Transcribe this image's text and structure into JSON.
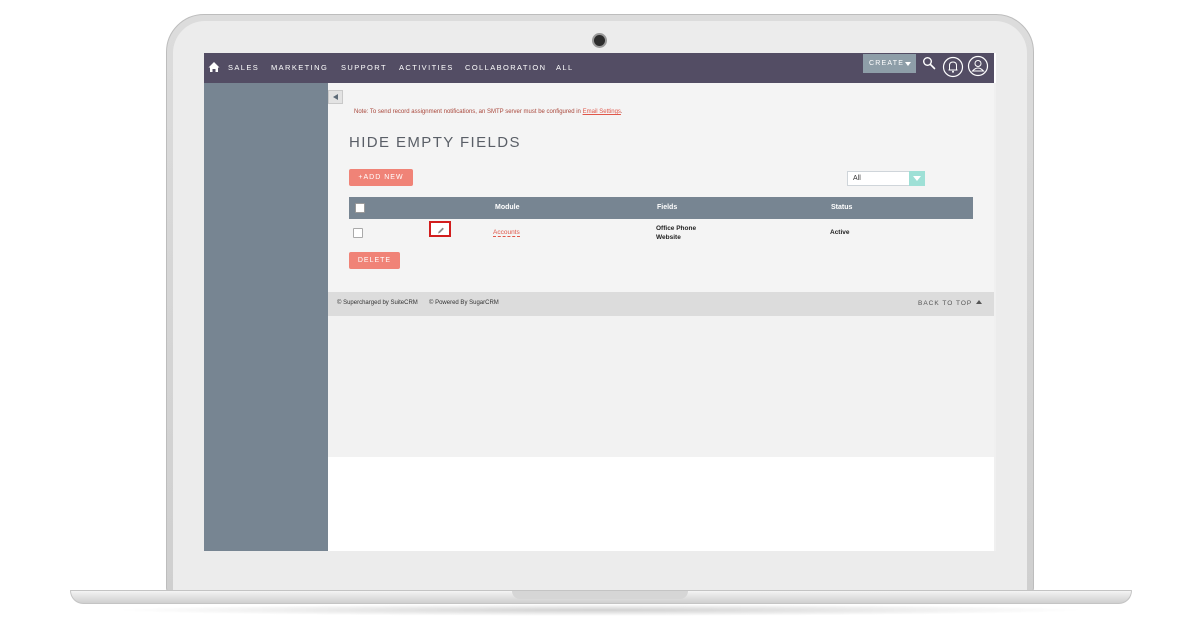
{
  "nav": {
    "items": [
      "SALES",
      "MARKETING",
      "SUPPORT",
      "ACTIVITIES",
      "COLLABORATION",
      "ALL"
    ],
    "create_label": "CREATE",
    "icons": {
      "home": "home-icon",
      "search": "search-icon",
      "notifications": "bell-icon",
      "profile": "user-icon"
    }
  },
  "notice": {
    "text": "Note: To send record assignment notifications, an SMTP server must be configured in ",
    "link": "Email Settings",
    "end": "."
  },
  "page": {
    "title": "HIDE EMPTY FIELDS",
    "add_new_label": "+ADD NEW",
    "filter_value": "All",
    "delete_label": "DELETE"
  },
  "table": {
    "headers": {
      "module": "Module",
      "fields": "Fields",
      "status": "Status"
    },
    "rows": [
      {
        "module": "Accounts",
        "fields_line1": "Office Phone",
        "fields_line2": "Website",
        "status": "Active"
      }
    ]
  },
  "footer": {
    "supercharged": "© Supercharged by SuiteCRM",
    "powered": "© Powered By SugarCRM",
    "back_to_top": "BACK TO TOP"
  },
  "colors": {
    "topbar": "#534d64",
    "sidebar": "#778592",
    "accent": "#f08377",
    "highlight": "#d21e1e"
  }
}
